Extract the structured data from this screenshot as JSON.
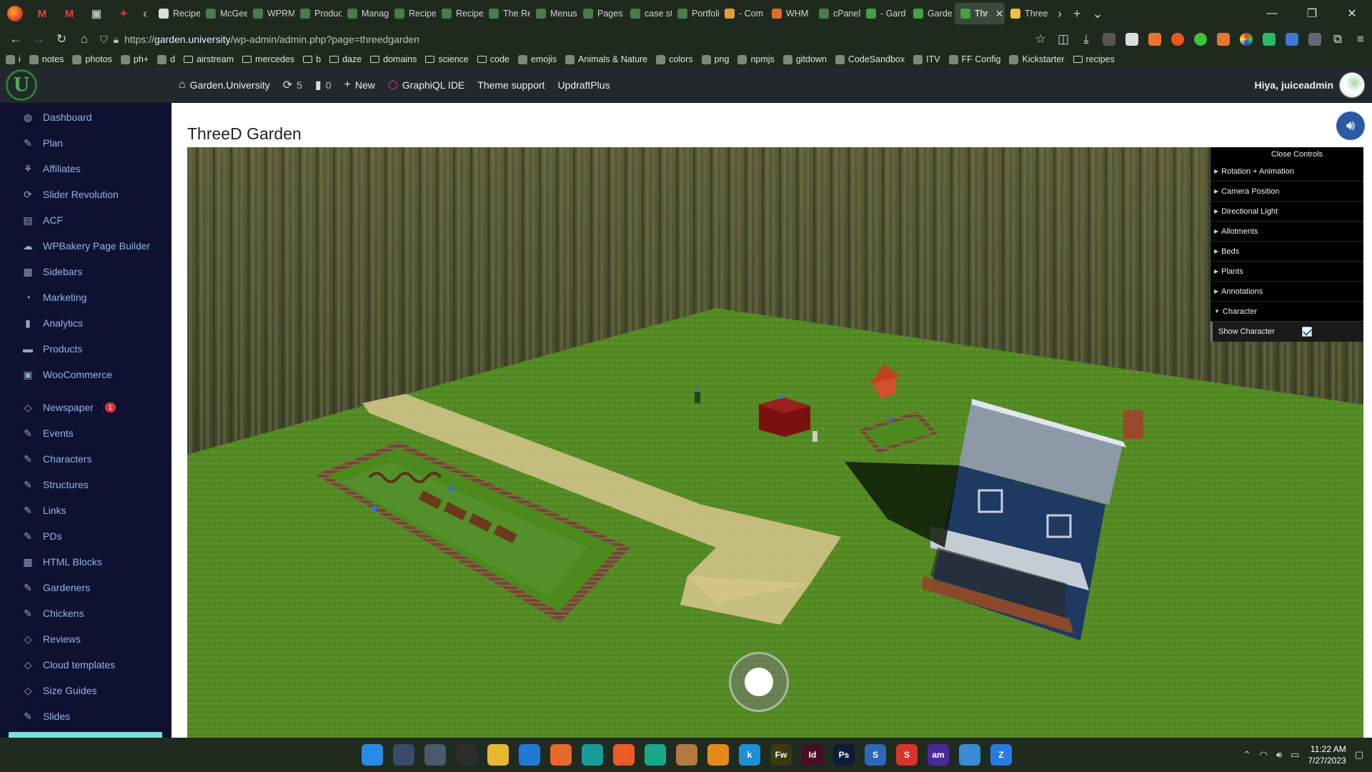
{
  "browser": {
    "tabs": [
      {
        "label": "Recipe: M",
        "color": "#e0e0e0"
      },
      {
        "label": "McGee Ho",
        "color": "#4a7b4a"
      },
      {
        "label": "WPRM Se",
        "color": "#4a7b4a"
      },
      {
        "label": "Products",
        "color": "#4a7b4a"
      },
      {
        "label": "Manage -",
        "color": "#4a7b4a"
      },
      {
        "label": "Recipes -",
        "color": "#4a7b4a"
      },
      {
        "label": "Recipe Sh",
        "color": "#4a7b4a"
      },
      {
        "label": "The Recip",
        "color": "#4a7b4a"
      },
      {
        "label": "Menus - C",
        "color": "#4a7b4a"
      },
      {
        "label": "Pages - Cr",
        "color": "#4a7b4a"
      },
      {
        "label": "case studi",
        "color": "#4a7b4a"
      },
      {
        "label": "Portfolio |",
        "color": "#4a7b4a"
      },
      {
        "label": "- Com",
        "color": "#e0a030"
      },
      {
        "label": "WHM",
        "color": "#e86a2a"
      },
      {
        "label": "cPanel Lo",
        "color": "#4a7b4a"
      },
      {
        "label": "- Gard",
        "color": "#43a047"
      },
      {
        "label": "Garde",
        "color": "#43a047"
      },
      {
        "label": "Thr",
        "color": "#43a047",
        "active": true
      },
      {
        "label": "Three",
        "color": "#f0c040"
      }
    ],
    "url_prefix": "https://",
    "url_host": "garden.university",
    "url_path": "/wp-admin/admin.php?page=threedgarden",
    "bookmarks": [
      {
        "label": "i",
        "kind": "icon"
      },
      {
        "label": "notes",
        "kind": "icon"
      },
      {
        "label": "photos",
        "kind": "icon"
      },
      {
        "label": "ph+",
        "kind": "icon"
      },
      {
        "label": "d",
        "kind": "icon"
      },
      {
        "label": "airstream",
        "kind": "folder"
      },
      {
        "label": "mercedes",
        "kind": "folder"
      },
      {
        "label": "b",
        "kind": "folder"
      },
      {
        "label": "daze",
        "kind": "folder"
      },
      {
        "label": "domains",
        "kind": "folder"
      },
      {
        "label": "science",
        "kind": "folder"
      },
      {
        "label": "code",
        "kind": "folder"
      },
      {
        "label": "emojis",
        "kind": "icon"
      },
      {
        "label": "Animals & Nature",
        "kind": "icon"
      },
      {
        "label": "colors",
        "kind": "icon"
      },
      {
        "label": "png",
        "kind": "icon"
      },
      {
        "label": "npmjs",
        "kind": "icon"
      },
      {
        "label": "gitdown",
        "kind": "icon"
      },
      {
        "label": "CodeSandbox",
        "kind": "icon"
      },
      {
        "label": "ITV",
        "kind": "icon"
      },
      {
        "label": "FF Config",
        "kind": "icon"
      },
      {
        "label": "Kickstarter",
        "kind": "icon"
      },
      {
        "label": "recipes",
        "kind": "folder"
      }
    ]
  },
  "adminbar": {
    "site_name": "Garden.University",
    "updates_count": "5",
    "comments_count": "0",
    "new_label": "New",
    "graphiql_label": "GraphiQL IDE",
    "theme_support_label": "Theme support",
    "updraft_label": "UpdraftPlus",
    "greeting": "Hiya, juiceadmin"
  },
  "sidebar": {
    "items": [
      {
        "label": "Dashboard",
        "icon": "dashboard-icon",
        "glyph": "◍"
      },
      {
        "label": "Plan",
        "icon": "pin-icon",
        "glyph": "✎"
      },
      {
        "label": "Affiliates",
        "icon": "affiliates-icon",
        "glyph": "⚘"
      },
      {
        "label": "Slider Revolution",
        "icon": "refresh-icon",
        "glyph": "⟳"
      },
      {
        "label": "ACF",
        "icon": "acf-icon",
        "glyph": "▤"
      },
      {
        "label": "WPBakery Page Builder",
        "icon": "cloud-icon",
        "glyph": "☁"
      },
      {
        "label": "Sidebars",
        "icon": "sidebars-icon",
        "glyph": "▦"
      },
      {
        "label": "Marketing",
        "icon": "megaphone-icon",
        "glyph": "◔"
      },
      {
        "label": "Analytics",
        "icon": "bar-chart-icon",
        "glyph": "▮"
      },
      {
        "label": "Products",
        "icon": "archive-icon",
        "glyph": "▬"
      },
      {
        "label": "WooCommerce",
        "icon": "woo-icon",
        "glyph": "▣"
      },
      {
        "label": "Newspaper",
        "icon": "newspaper-icon",
        "glyph": "◇",
        "badge": "1"
      },
      {
        "label": "Events",
        "icon": "pin-icon",
        "glyph": "✎"
      },
      {
        "label": "Characters",
        "icon": "pin-icon",
        "glyph": "✎"
      },
      {
        "label": "Structures",
        "icon": "pin-icon",
        "glyph": "✎"
      },
      {
        "label": "Links",
        "icon": "pin-icon",
        "glyph": "✎"
      },
      {
        "label": "PDs",
        "icon": "pin-icon",
        "glyph": "✎"
      },
      {
        "label": "HTML Blocks",
        "icon": "grid-icon",
        "glyph": "▦"
      },
      {
        "label": "Gardeners",
        "icon": "pin-icon",
        "glyph": "✎"
      },
      {
        "label": "Chickens",
        "icon": "pin-icon",
        "glyph": "✎"
      },
      {
        "label": "Reviews",
        "icon": "diamond-icon",
        "glyph": "◇"
      },
      {
        "label": "Cloud templates",
        "icon": "diamond-icon",
        "glyph": "◇"
      },
      {
        "label": "Size Guides",
        "icon": "diamond-icon",
        "glyph": "◇"
      },
      {
        "label": "Slides",
        "icon": "pin-icon",
        "glyph": "✎"
      }
    ]
  },
  "page": {
    "title": "ThreeD Garden"
  },
  "gui": {
    "close_label": "Close Controls",
    "folders": [
      {
        "label": "Rotation + Animation",
        "open": false
      },
      {
        "label": "Camera Position",
        "open": false
      },
      {
        "label": "Directional Light",
        "open": false
      },
      {
        "label": "Allotments",
        "open": false
      },
      {
        "label": "Beds",
        "open": false
      },
      {
        "label": "Plants",
        "open": false
      },
      {
        "label": "Annotations",
        "open": false
      },
      {
        "label": "Character",
        "open": true
      }
    ],
    "show_character_label": "Show Character",
    "show_character": true
  },
  "taskbar": {
    "apps": [
      {
        "name": "start-icon",
        "color": "#2b8ae6",
        "text": ""
      },
      {
        "name": "calculator-icon",
        "color": "#3a4a6a",
        "text": ""
      },
      {
        "name": "settings-icon",
        "color": "#4a5a6a",
        "text": ""
      },
      {
        "name": "terminal-icon",
        "color": "#2c2c2c",
        "text": ""
      },
      {
        "name": "file-explorer-icon",
        "color": "#e8b730",
        "text": ""
      },
      {
        "name": "vscode-icon",
        "color": "#1f7ad6",
        "text": ""
      },
      {
        "name": "firefox-icon",
        "color": "#e8672a",
        "text": ""
      },
      {
        "name": "edge-icon",
        "color": "#1a9b9b",
        "text": ""
      },
      {
        "name": "swift-icon",
        "color": "#ee5a2a",
        "text": ""
      },
      {
        "name": "gitkraken-icon",
        "color": "#17a88a",
        "text": ""
      },
      {
        "name": "box-icon",
        "color": "#b07a40",
        "text": ""
      },
      {
        "name": "blender-icon",
        "color": "#e58a1a",
        "text": ""
      },
      {
        "name": "k-icon",
        "color": "#1d8fd6",
        "text": "k"
      },
      {
        "name": "fireworks-icon",
        "color": "#3a3a10",
        "text": "Fw"
      },
      {
        "name": "indesign-icon",
        "color": "#4a0e24",
        "text": "Id"
      },
      {
        "name": "photoshop-icon",
        "color": "#0e1a3a",
        "text": "Ps"
      },
      {
        "name": "s-blue-icon",
        "color": "#2a6ab6",
        "text": "S"
      },
      {
        "name": "s-red-icon",
        "color": "#d9342a",
        "text": "S"
      },
      {
        "name": "amazon-music-icon",
        "color": "#4a2a9a",
        "text": "am"
      },
      {
        "name": "paint-icon",
        "color": "#3a8ad6",
        "text": ""
      },
      {
        "name": "zoom-icon",
        "color": "#2a7ae6",
        "text": "Z"
      }
    ],
    "time": "11:22 AM",
    "date": "7/27/2023"
  }
}
